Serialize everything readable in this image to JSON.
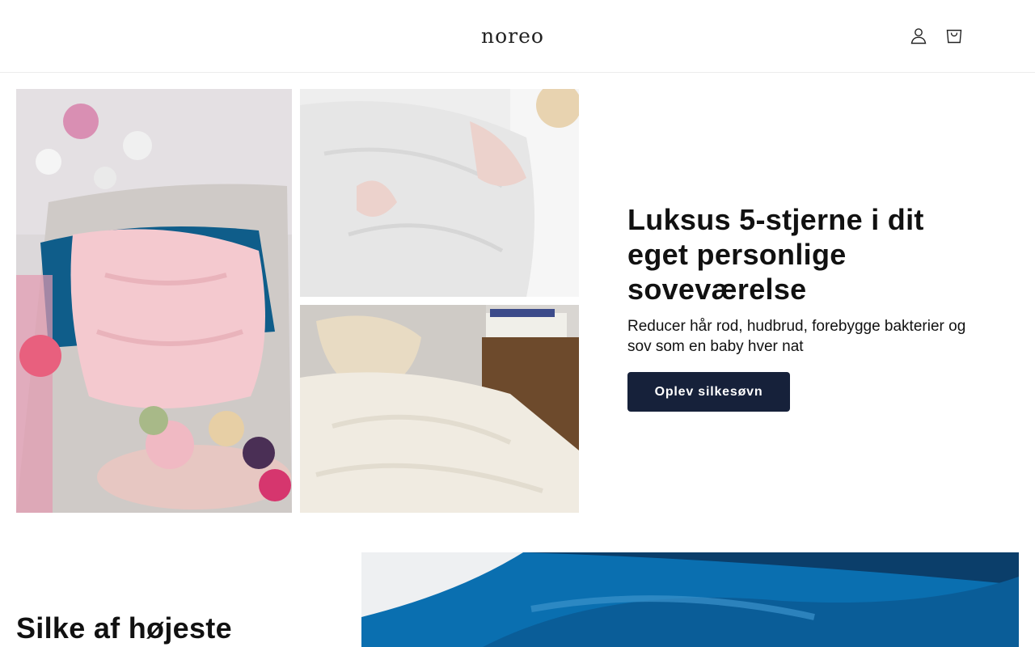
{
  "header": {
    "logo": "noreo",
    "account_icon": "account-icon",
    "cart_icon": "cart-icon"
  },
  "hero": {
    "title": "Luksus 5-stjerne i dit eget personlige soveværelse",
    "subtitle": "Reducer hår rod, hudbrud, forebygge bakterier og sov som en baby hver nat",
    "cta_label": "Oplev silkesøvn",
    "cta_color": "#16213a"
  },
  "section2": {
    "title": "Silke af højeste"
  },
  "colors": {
    "accent": "#16213a",
    "silk_blue": "#0a6fb0",
    "pink_silk": "#f4c9cf"
  }
}
